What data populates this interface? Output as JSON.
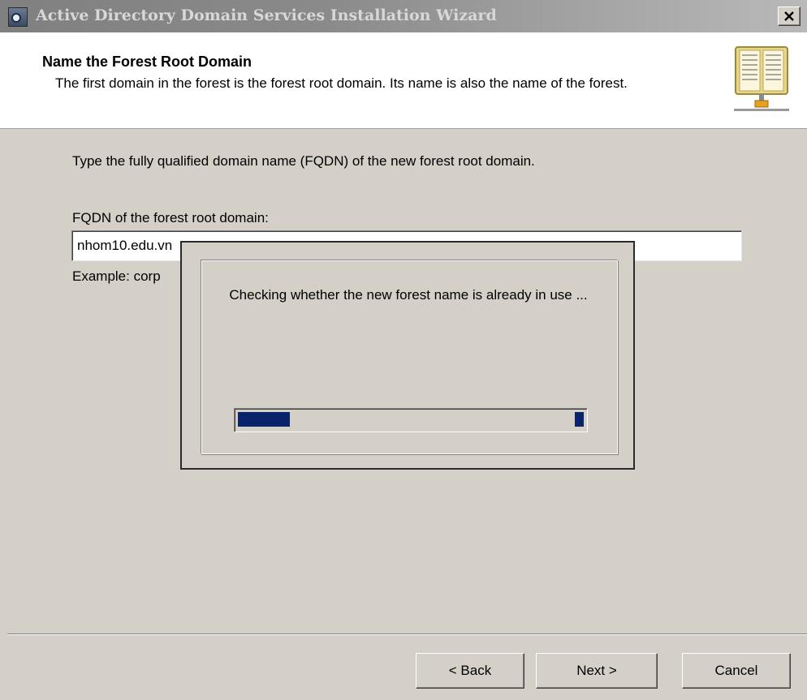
{
  "window": {
    "title": "Active Directory Domain Services Installation Wizard",
    "close_label": "✕"
  },
  "header": {
    "title": "Name the Forest Root Domain",
    "description": "The first domain in the forest is the forest root domain. Its name is also the name of the forest.",
    "icon": "directory-book-icon"
  },
  "form": {
    "instruction": "Type the fully qualified domain name (FQDN) of the new forest root domain.",
    "fqdn_label": "FQDN of the forest root domain:",
    "fqdn_value": "nhom10.edu.vn",
    "example": "Example: corp"
  },
  "progress_dialog": {
    "message": "Checking whether the new forest name is already in use ...",
    "progress_fraction": 0.15
  },
  "buttons": {
    "back": "< Back",
    "next": "Next >",
    "cancel": "Cancel"
  },
  "colors": {
    "face": "#d4d0c8",
    "progress": "#0a246a"
  }
}
